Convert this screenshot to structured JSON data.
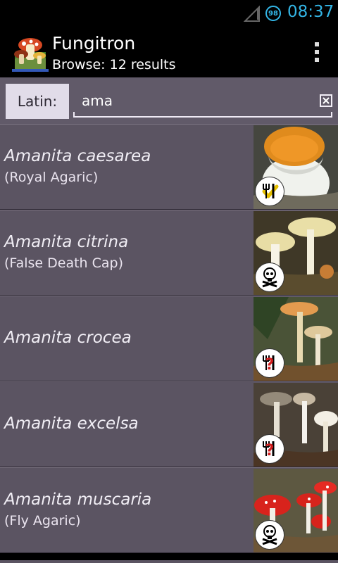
{
  "status_bar": {
    "battery": "98",
    "time": "08:37"
  },
  "action_bar": {
    "title": "Fungitron",
    "subtitle": "Browse: 12 results"
  },
  "search": {
    "mode_label": "Latin:",
    "query": "ama"
  },
  "results": [
    {
      "latin": "Amanita caesarea",
      "common": "(Royal Agaric)",
      "badge": "edible-icon"
    },
    {
      "latin": "Amanita citrina",
      "common": "(False Death Cap)",
      "badge": "poison-icon"
    },
    {
      "latin": "Amanita crocea",
      "common": "",
      "badge": "unknown-edibility-icon"
    },
    {
      "latin": "Amanita excelsa",
      "common": "",
      "badge": "unknown-edibility-icon"
    },
    {
      "latin": "Amanita muscaria",
      "common": "(Fly Agaric)",
      "badge": "poison-icon"
    }
  ],
  "colors": {
    "status_accent": "#33b5e5",
    "list_background": "#5b5462",
    "search_background": "#615a69"
  }
}
